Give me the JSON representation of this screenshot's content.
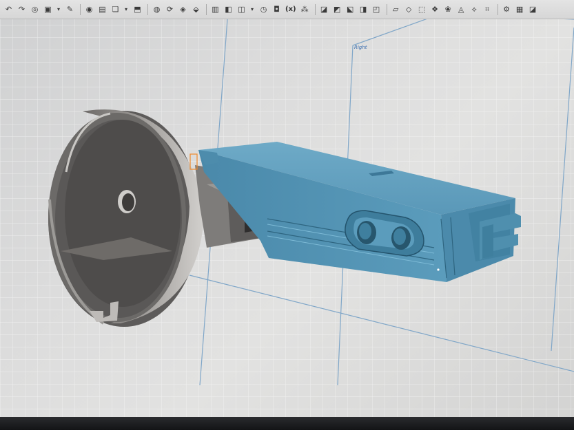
{
  "toolbar": {
    "items": [
      {
        "icon": "undo-icon",
        "glyph": "↶"
      },
      {
        "icon": "redo-icon",
        "glyph": "↷"
      },
      {
        "icon": "stop-icon",
        "glyph": "◎"
      },
      {
        "icon": "save-icon",
        "glyph": "▣"
      },
      {
        "icon": "dropdown-icon",
        "glyph": "▾",
        "small": true
      },
      {
        "icon": "sketch-icon",
        "glyph": "✎"
      },
      {
        "sep": true
      },
      {
        "icon": "view-icon",
        "glyph": "◉"
      },
      {
        "icon": "display-icon",
        "glyph": "▤"
      },
      {
        "icon": "folder-icon",
        "glyph": "❏"
      },
      {
        "icon": "dropdown-icon",
        "glyph": "▾",
        "small": true
      },
      {
        "icon": "extrude-icon",
        "glyph": "⬒"
      },
      {
        "sep": true
      },
      {
        "icon": "revolve-icon",
        "glyph": "◍"
      },
      {
        "icon": "sweep-icon",
        "glyph": "⟳"
      },
      {
        "icon": "loft-icon",
        "glyph": "◈"
      },
      {
        "icon": "rib-icon",
        "glyph": "⬙"
      },
      {
        "sep": true
      },
      {
        "icon": "fillet-icon",
        "glyph": "▥"
      },
      {
        "icon": "chamfer-icon",
        "glyph": "◧"
      },
      {
        "icon": "draft-icon",
        "glyph": "◫"
      },
      {
        "icon": "dropdown-icon",
        "glyph": "▾",
        "small": true
      },
      {
        "icon": "clock-icon",
        "glyph": "◷"
      },
      {
        "icon": "shell-icon",
        "glyph": "◘"
      },
      {
        "icon": "variable-icon",
        "glyph": "(x)",
        "text": true
      },
      {
        "icon": "pattern-icon",
        "glyph": "⁂"
      },
      {
        "sep": true
      },
      {
        "icon": "boolean-icon",
        "glyph": "◪"
      },
      {
        "icon": "split-icon",
        "glyph": "◩"
      },
      {
        "icon": "transform-icon",
        "glyph": "⬕"
      },
      {
        "icon": "mirror-icon",
        "glyph": "◨"
      },
      {
        "icon": "mate-icon",
        "glyph": "◰"
      },
      {
        "sep": true
      },
      {
        "icon": "plane-icon",
        "glyph": "▱"
      },
      {
        "icon": "helix-icon",
        "glyph": "◇"
      },
      {
        "icon": "surface-icon",
        "glyph": "⬚"
      },
      {
        "icon": "curve-icon",
        "glyph": "❖"
      },
      {
        "icon": "wrap-icon",
        "glyph": "❀"
      },
      {
        "icon": "measure-icon",
        "glyph": "◬"
      },
      {
        "icon": "section-icon",
        "glyph": "⟡"
      },
      {
        "icon": "thicken-icon",
        "glyph": "⌗"
      },
      {
        "sep": true
      },
      {
        "icon": "settings-icon",
        "glyph": "⚙"
      },
      {
        "icon": "grid-icon",
        "glyph": "▦"
      },
      {
        "icon": "more-icon",
        "glyph": "◪"
      }
    ]
  },
  "viewport": {
    "plane_label": "Right",
    "colors": {
      "selected_body": "#5b9cbc",
      "selected_body_dark": "#3f7f9e",
      "hub_body": "#8a8886",
      "plane_line": "#7fa6c8",
      "grid_line": "#ffffff"
    }
  }
}
